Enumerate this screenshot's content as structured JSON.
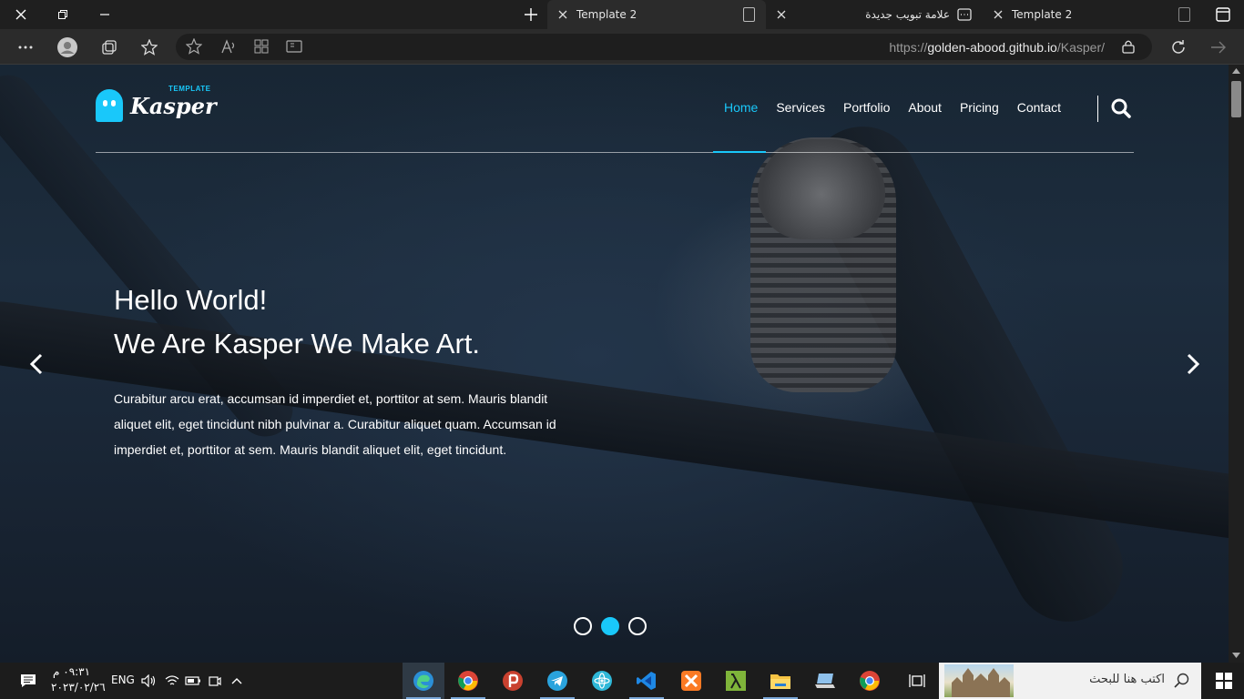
{
  "browser": {
    "tabs": [
      {
        "label": "Template 2",
        "active": false
      },
      {
        "label": "علامة تبويب جديدة",
        "active": false
      },
      {
        "label": "Template 2",
        "active": true
      }
    ],
    "url_prefix": "https://",
    "url_host": "golden-abood.github.io",
    "url_path": "/Kasper/"
  },
  "site": {
    "logo_small": "TEMPLATE",
    "logo_main": "Kasper",
    "nav_links": [
      "Home",
      "Services",
      "Portfolio",
      "About",
      "Pricing",
      "Contact"
    ],
    "active_link": "Home",
    "hero_title_line1": "Hello World!",
    "hero_title_line2": "We Are Kasper We Make Art.",
    "hero_text": "Curabitur arcu erat, accumsan id imperdiet et, porttitor at sem. Mauris blandit aliquet elit, eget tincidunt nibh pulvinar a. Curabitur aliquet quam. Accumsan id imperdiet et, porttitor at sem. Mauris blandit aliquet elit, eget tincidunt.",
    "slider_active_index": 1,
    "slider_count": 3
  },
  "taskbar": {
    "time": "٠٩:٣١ م",
    "date": "٢٠٢٣/٠٢/٢٦",
    "language": "ENG",
    "search_placeholder": "اكتب هنا للبحث"
  },
  "colors": {
    "accent": "#19c8fa",
    "chrome_bg": "#1f1f1f",
    "toolbar_bg": "#2b2b2b"
  }
}
